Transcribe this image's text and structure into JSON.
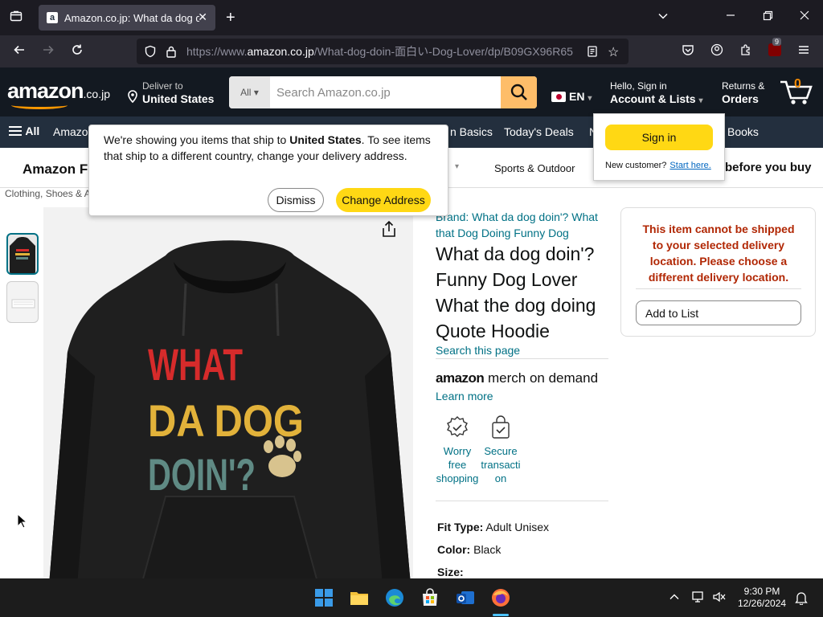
{
  "browser": {
    "tab_title": "Amazon.co.jp: What da dog doin'? Funny Dog Lover",
    "url_prefix": "https://www.",
    "url_domain": "amazon.co.jp",
    "url_path": "/What-dog-doin-面白い-Dog-Lover/dp/B09GX96R65",
    "extension_badge": "9"
  },
  "header": {
    "logo_text": "amazon",
    "logo_suffix": ".co.jp",
    "deliver_label": "Deliver to",
    "deliver_value": "United States",
    "search_category": "All",
    "search_placeholder": "Search Amazon.co.jp",
    "language": "EN",
    "account_greeting": "Hello, Sign in",
    "account_label": "Account & Lists",
    "returns_label": "Returns &",
    "orders_label": "Orders",
    "cart_count": "0"
  },
  "nav": {
    "menu_label": "All",
    "items": [
      "Amazo",
      "n Basics",
      "Today's Deals",
      "N",
      "Books"
    ]
  },
  "subnav": {
    "store_name": "Amazon F",
    "sports": "Sports & Outdoor",
    "promo": "before you buy"
  },
  "breadcrumb": "Clothing, Shoes & A",
  "location_popover": {
    "text_before": "We're showing you items that ship to ",
    "text_bold": "United States",
    "text_after": ". To see items that ship to a different country, change your delivery address.",
    "dismiss_label": "Dismiss",
    "change_label": "Change Address"
  },
  "signin_popover": {
    "button_label": "Sign in",
    "new_customer": "New customer?",
    "start_here": "Start here."
  },
  "product": {
    "brand_link": "Brand: What da dog doin'? What that Dog Doing Funny Dog",
    "title": "What da dog doin'? Funny Dog Lover What the dog doing Quote Hoodie",
    "search_page": "Search this page",
    "merch_logo": "amazon",
    "merch_text": " merch on demand",
    "learn_more": "Learn more",
    "features": [
      {
        "icon": "badge-check-icon",
        "label": "Worry free shopping"
      },
      {
        "icon": "bag-check-icon",
        "label": "Secure transacti on"
      }
    ],
    "specs": [
      {
        "label": "Fit Type:",
        "value": "Adult Unisex"
      },
      {
        "label": "Color:",
        "value": "Black"
      },
      {
        "label": "Size:",
        "value": ""
      }
    ],
    "shirt_print": [
      "WHAT",
      "DA DOG",
      "DOIN'?"
    ]
  },
  "buybox": {
    "warning": "This item cannot be shipped to your selected delivery location. Please choose a different delivery location.",
    "add_to_list": "Add to List"
  },
  "taskbar": {
    "time": "9:30 PM",
    "date": "12/26/2024"
  },
  "colors": {
    "amazon_dark": "#131921",
    "amazon_nav": "#232f3e",
    "amazon_orange": "#ff9900",
    "button_yellow": "#ffd814",
    "link_teal": "#007185",
    "error_red": "#b12704"
  }
}
